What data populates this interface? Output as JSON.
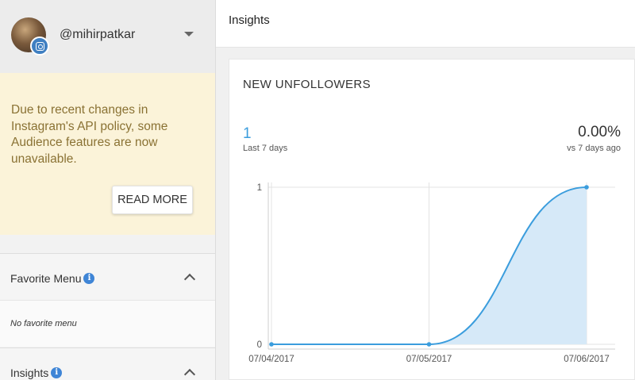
{
  "profile": {
    "username": "@mihirpatkar"
  },
  "notice": {
    "text": "Due to recent changes in Instagram's API policy, some Audience features are now unavailable.",
    "button_label": "READ MORE"
  },
  "sidebar": {
    "favorite": {
      "title": "Favorite Menu",
      "empty_text": "No favorite menu"
    },
    "insights": {
      "title": "Insights"
    }
  },
  "header": {
    "title": "Insights"
  },
  "card": {
    "title": "NEW UNFOLLOWERS",
    "value": "1",
    "value_label": "Last 7 days",
    "change": "0.00%",
    "change_label": "vs 7 days ago"
  },
  "colors": {
    "accent": "#3b9ddd",
    "area_fill": "#d6e9f8",
    "notice_bg": "#fbf3d9",
    "notice_text": "#8a7234"
  },
  "chart_data": {
    "type": "area",
    "categories": [
      "07/04/2017",
      "07/05/2017",
      "07/06/2017"
    ],
    "values": [
      0,
      0,
      1
    ],
    "ylim": [
      0,
      1
    ],
    "yticks": [
      "0",
      "1"
    ],
    "grid": true
  }
}
